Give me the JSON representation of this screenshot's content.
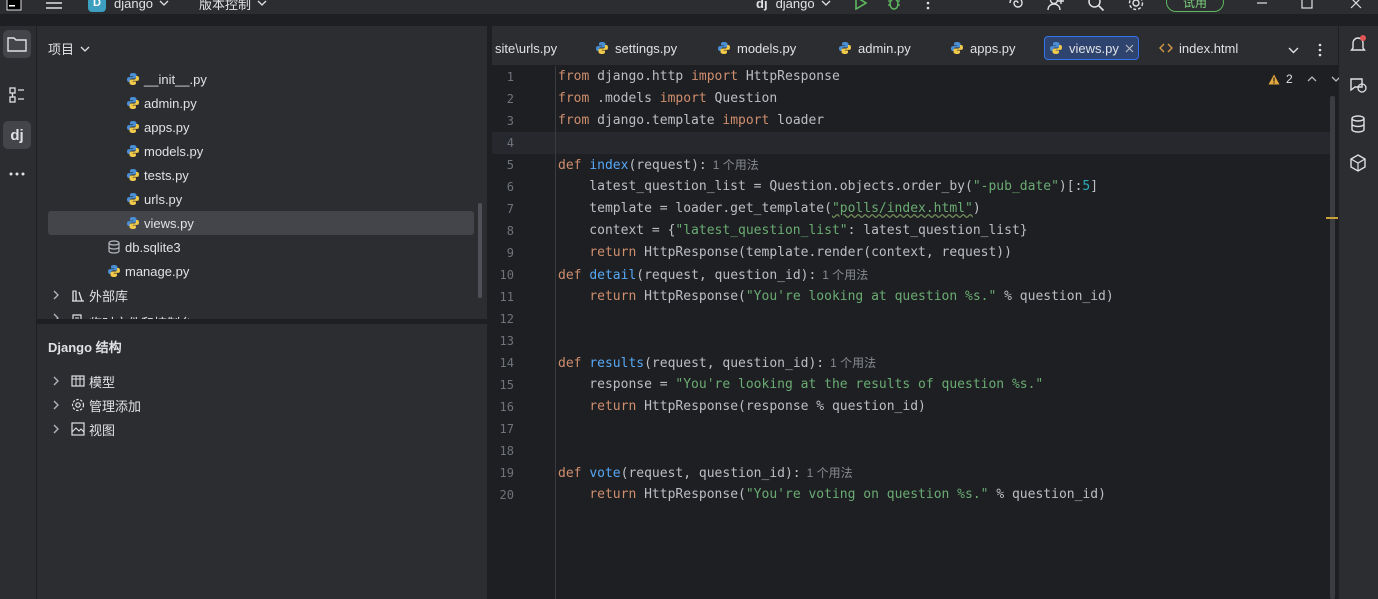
{
  "titlebar": {
    "project_initial": "D",
    "project_name": "django",
    "vcs_label": "版本控制",
    "run_config": "django",
    "trial_label": "试用"
  },
  "project_panel": {
    "title": "项目",
    "items": [
      {
        "label": "__init__.py",
        "type": "python"
      },
      {
        "label": "admin.py",
        "type": "python"
      },
      {
        "label": "apps.py",
        "type": "python"
      },
      {
        "label": "models.py",
        "type": "python"
      },
      {
        "label": "tests.py",
        "type": "python"
      },
      {
        "label": "urls.py",
        "type": "python"
      },
      {
        "label": "views.py",
        "type": "python",
        "selected": true
      },
      {
        "label": "db.sqlite3",
        "type": "db"
      },
      {
        "label": "manage.py",
        "type": "python"
      },
      {
        "label": "外部库",
        "type": "library"
      },
      {
        "label": "临时文件和控制台",
        "type": "scratch"
      }
    ]
  },
  "django_structure": {
    "title": "Django 结构",
    "items": [
      {
        "label": "模型",
        "icon": "table-icon"
      },
      {
        "label": "管理添加",
        "icon": "gear-icon"
      },
      {
        "label": "视图",
        "icon": "image-icon"
      }
    ]
  },
  "tabs": [
    {
      "label": "site\\urls.py",
      "type": "python"
    },
    {
      "label": "settings.py",
      "type": "python"
    },
    {
      "label": "models.py",
      "type": "python"
    },
    {
      "label": "admin.py",
      "type": "python"
    },
    {
      "label": "apps.py",
      "type": "python"
    },
    {
      "label": "views.py",
      "type": "python",
      "active": true
    },
    {
      "label": "index.html",
      "type": "html"
    }
  ],
  "editor": {
    "warning_count": "2",
    "usage_hint": "1 个用法",
    "line_numbers": [
      "1",
      "2",
      "3",
      "4",
      "5",
      "6",
      "7",
      "8",
      "9",
      "10",
      "11",
      "12",
      "13",
      "14",
      "15",
      "16",
      "17",
      "18",
      "19",
      "20"
    ],
    "lines": [
      "from django.http import HttpResponse",
      "from .models import Question",
      "from django.template import loader",
      "",
      "def index(request):",
      "    latest_question_list = Question.objects.order_by(\"-pub_date\")[:5]",
      "    template = loader.get_template(\"polls/index.html\")",
      "    context = {\"latest_question_list\": latest_question_list}",
      "    return HttpResponse(template.render(context, request))",
      "def detail(request, question_id):",
      "    return HttpResponse(\"You're looking at question %s.\" % question_id)",
      "",
      "",
      "def results(request, question_id):",
      "    response = \"You're looking at the results of question %s.\"",
      "    return HttpResponse(response % question_id)",
      "",
      "",
      "def vote(request, question_id):",
      "    return HttpResponse(\"You're voting on question %s.\" % question_id)"
    ]
  },
  "colors": {
    "accent": "#3574f0",
    "keyword": "#cf8e6d",
    "function": "#56a8f5",
    "string": "#6aab73",
    "number": "#2aacb8"
  }
}
